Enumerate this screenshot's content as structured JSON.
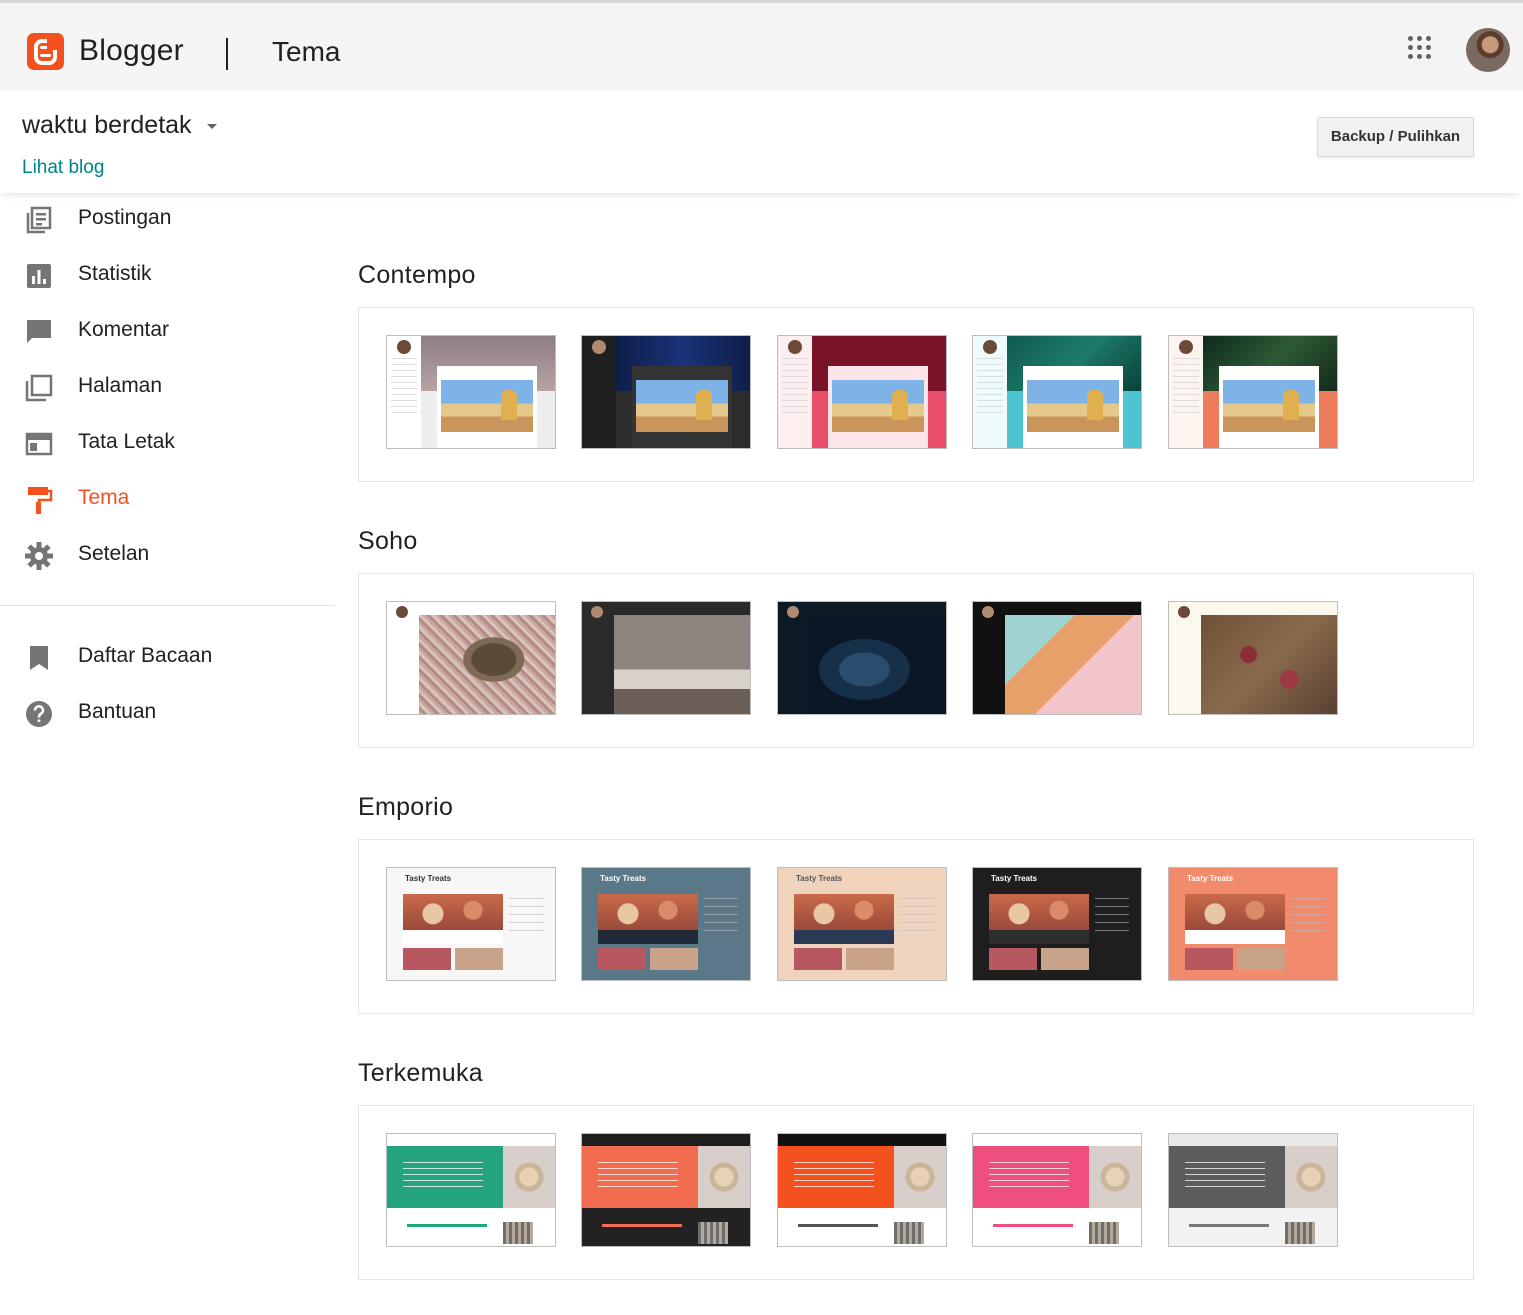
{
  "app": {
    "brand": "Blogger",
    "page_title": "Tema"
  },
  "blog": {
    "name": "waktu berdetak",
    "view_link": "Lihat blog",
    "backup_label": "Backup / Pulihkan"
  },
  "sidebar": {
    "items": [
      {
        "label": "Postingan",
        "icon": "posts-icon"
      },
      {
        "label": "Statistik",
        "icon": "stats-icon"
      },
      {
        "label": "Komentar",
        "icon": "comment-icon"
      },
      {
        "label": "Halaman",
        "icon": "pages-icon"
      },
      {
        "label": "Tata Letak",
        "icon": "layout-icon"
      },
      {
        "label": "Tema",
        "icon": "theme-icon",
        "active": true
      },
      {
        "label": "Setelan",
        "icon": "gear-icon"
      }
    ],
    "secondary": [
      {
        "label": "Daftar Bacaan",
        "icon": "bookmark-icon"
      },
      {
        "label": "Bantuan",
        "icon": "help-icon"
      }
    ]
  },
  "themes": [
    {
      "title": "Contempo",
      "variants": 5
    },
    {
      "title": "Soho",
      "variants": 5
    },
    {
      "title": "Emporio",
      "variants": 5,
      "thumb_title": "Tasty Treats"
    },
    {
      "title": "Terkemuka",
      "variants": 5
    }
  ],
  "colors": {
    "accent": "#f4511e",
    "link": "#00838f",
    "appbar": "#f5f5f5"
  }
}
